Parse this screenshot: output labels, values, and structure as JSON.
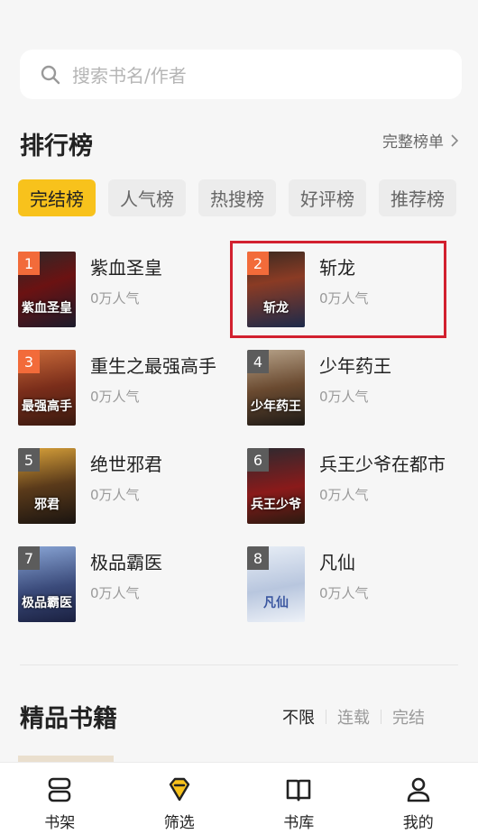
{
  "search": {
    "placeholder": "搜索书名/作者"
  },
  "ranking": {
    "title": "排行榜",
    "more_label": "完整榜单",
    "tabs": [
      {
        "label": "完结榜",
        "active": true
      },
      {
        "label": "人气榜",
        "active": false
      },
      {
        "label": "热搜榜",
        "active": false
      },
      {
        "label": "好评榜",
        "active": false
      },
      {
        "label": "推荐榜",
        "active": false
      }
    ],
    "books": [
      {
        "rank": "1",
        "title": "紫血圣皇",
        "popularity": "0万人气",
        "cover_text": "紫血圣皇"
      },
      {
        "rank": "2",
        "title": "斩龙",
        "popularity": "0万人气",
        "cover_text": "斩龙"
      },
      {
        "rank": "3",
        "title": "重生之最强高手",
        "popularity": "0万人气",
        "cover_text": "最强高手"
      },
      {
        "rank": "4",
        "title": "少年药王",
        "popularity": "0万人气",
        "cover_text": "少年药王"
      },
      {
        "rank": "5",
        "title": "绝世邪君",
        "popularity": "0万人气",
        "cover_text": "邪君"
      },
      {
        "rank": "6",
        "title": "兵王少爷在都市",
        "popularity": "0万人气",
        "cover_text": "兵王少爷"
      },
      {
        "rank": "7",
        "title": "极品霸医",
        "popularity": "0万人气",
        "cover_text": "极品霸医"
      },
      {
        "rank": "8",
        "title": "凡仙",
        "popularity": "0万人气",
        "cover_text": "凡仙"
      }
    ]
  },
  "premium": {
    "title": "精品书籍",
    "filters": [
      {
        "label": "不限",
        "selected": true
      },
      {
        "label": "连载",
        "selected": false
      },
      {
        "label": "完结",
        "selected": false
      }
    ]
  },
  "bottom_nav": [
    {
      "label": "书架",
      "icon": "bookshelf-icon"
    },
    {
      "label": "筛选",
      "icon": "filter-diamond-icon"
    },
    {
      "label": "书库",
      "icon": "open-book-icon"
    },
    {
      "label": "我的",
      "icon": "user-icon"
    }
  ],
  "colors": {
    "accent": "#f8c21c",
    "badge_hot": "#f26b3a",
    "badge_gray": "#5c5c5c",
    "highlight": "#d2202f"
  }
}
